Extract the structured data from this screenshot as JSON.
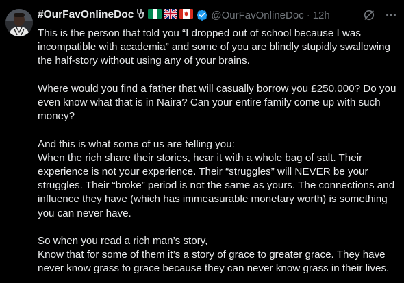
{
  "tweet": {
    "display_name": "#OurFavOnlineDoc",
    "handle": "@OurFavOnlineDoc",
    "separator": "·",
    "time": "12h",
    "emojis": [
      "stethoscope-icon",
      "nigeria-flag-icon",
      "uk-flag-icon",
      "canada-flag-icon"
    ],
    "paragraphs": [
      "This is the person that told you “I dropped out of school because I was incompatible with academia” and some of you are blindly stupidly swallowing the half-story without using any of your brains.",
      "Where would you find a father that will casually borrow you £250,000? Do you even know what that is in Naira? Can your entire family come up with such money?",
      "And this is what some of us are telling you:\nWhen the rich share their stories, hear it with a whole bag of salt. Their experience is not your experience. Their “struggles” will NEVER be your struggles. Their “broke” period is not the same as yours. The connections and influence they have (which has immeasurable monetary worth) is something you can never have.",
      "So when you read a rich man’s story,\nKnow that for some of them it’s a story of grace to greater grace. They have never know grass to grace because they can never know grass in their lives."
    ]
  },
  "colors": {
    "background": "#000000",
    "text": "#e7e9ea",
    "secondary": "#71767b",
    "verified": "#1d9bf0"
  }
}
